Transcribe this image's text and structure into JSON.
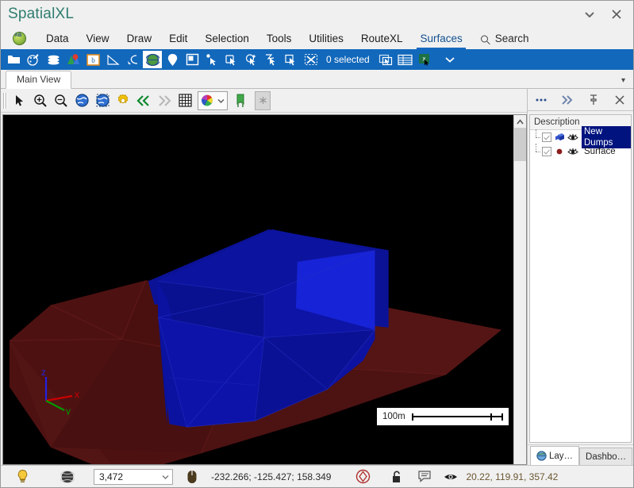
{
  "window": {
    "title": "SpatialXL",
    "buttons": [
      {
        "name": "window-menu-chevron",
        "glyph": "▼"
      },
      {
        "name": "close-window",
        "glyph": "✕"
      }
    ]
  },
  "menu": {
    "logo_icon": "app-globe-logo-icon",
    "items": [
      {
        "label": "Data",
        "active": false
      },
      {
        "label": "View",
        "active": false
      },
      {
        "label": "Draw",
        "active": false
      },
      {
        "label": "Edit",
        "active": false
      },
      {
        "label": "Selection",
        "active": false
      },
      {
        "label": "Tools",
        "active": false
      },
      {
        "label": "Utilities",
        "active": false
      },
      {
        "label": "RouteXL",
        "active": false
      },
      {
        "label": "Surfaces",
        "active": true
      }
    ],
    "search_label": "Search"
  },
  "ribbon": {
    "background": "#1268bb",
    "selection_label": "0 selected",
    "icons": [
      "open-folder-icon",
      "palette-brush-icon",
      "layers-stack-icon",
      "map-pin-icon",
      "boundary-b-icon",
      "angle-measure-icon",
      "curve-tool-icon",
      "globe-icon",
      "marker-pin-icon",
      "panel-layout-icon",
      "select-point-icon",
      "select-polygon-icon",
      "select-circle-icon",
      "select-lasso-icon",
      "select-rectangle-icon",
      "clear-selection-icon",
      "select-window-icon",
      "table-grid-icon",
      "excel-export-icon",
      "overflow-chevron-icon"
    ]
  },
  "document_tabs": {
    "tabs": [
      {
        "label": "Main View",
        "active": true
      }
    ],
    "overflow_glyph": "▾"
  },
  "view_toolbar": {
    "icons": [
      "pointer-select-icon",
      "zoom-in-icon",
      "zoom-out-icon",
      "zoom-extents-globe-icon",
      "zoom-window-globe-icon",
      "settings-gear-icon",
      "previous-view-icon",
      "next-view-icon",
      "grid-icon",
      "color-palette-dropdown-icon",
      "green-flag-icon",
      "asterisk-disabled-icon"
    ]
  },
  "viewport": {
    "background": "#000000",
    "scalebar_label": "100m",
    "axis": {
      "x": "x",
      "y": "y",
      "z": "z",
      "x_color": "#cc0000",
      "y_color": "#009900",
      "z_color": "#2222dd"
    },
    "objects": [
      {
        "name": "New Dumps",
        "color": "#0a11a8",
        "type": "prism"
      },
      {
        "name": "Surface",
        "color": "#4a0f0f",
        "type": "surface"
      }
    ]
  },
  "dock": {
    "header_buttons": [
      {
        "name": "more-options",
        "glyph": "…"
      },
      {
        "name": "collapse-panel",
        "glyph": "»"
      },
      {
        "name": "pin-panel",
        "glyph": "⚲"
      },
      {
        "name": "close-panel",
        "glyph": "✕"
      }
    ],
    "list_header": "Description",
    "layers": [
      {
        "label": "New Dumps",
        "checked": true,
        "visible": true,
        "selected": true,
        "icon": "cube-layer-icon",
        "color": "#1a44c8"
      },
      {
        "label": "Surface",
        "checked": true,
        "visible": true,
        "selected": false,
        "icon": "point-layer-icon",
        "color": "#8b1b1b"
      }
    ],
    "tabs": [
      {
        "label": "Lay…",
        "icon": "globe-icon",
        "active": true
      },
      {
        "label": "Dashbo…",
        "icon": "",
        "active": false
      }
    ]
  },
  "statusbar": {
    "lightbulb_icon": "lightbulb-icon",
    "globe_icon": "dark-globe-icon",
    "count_value": "3,472",
    "mouse_icon": "mouse-icon",
    "cursor_coords": "-232.266; -125.427; 158.349",
    "target_icon": "snap-target-icon",
    "lock_icon": "unlock-icon",
    "note_icon": "note-icon",
    "eye_icon": "eye-icon",
    "camera_coords": "20.22, 119.91, 357.42"
  }
}
